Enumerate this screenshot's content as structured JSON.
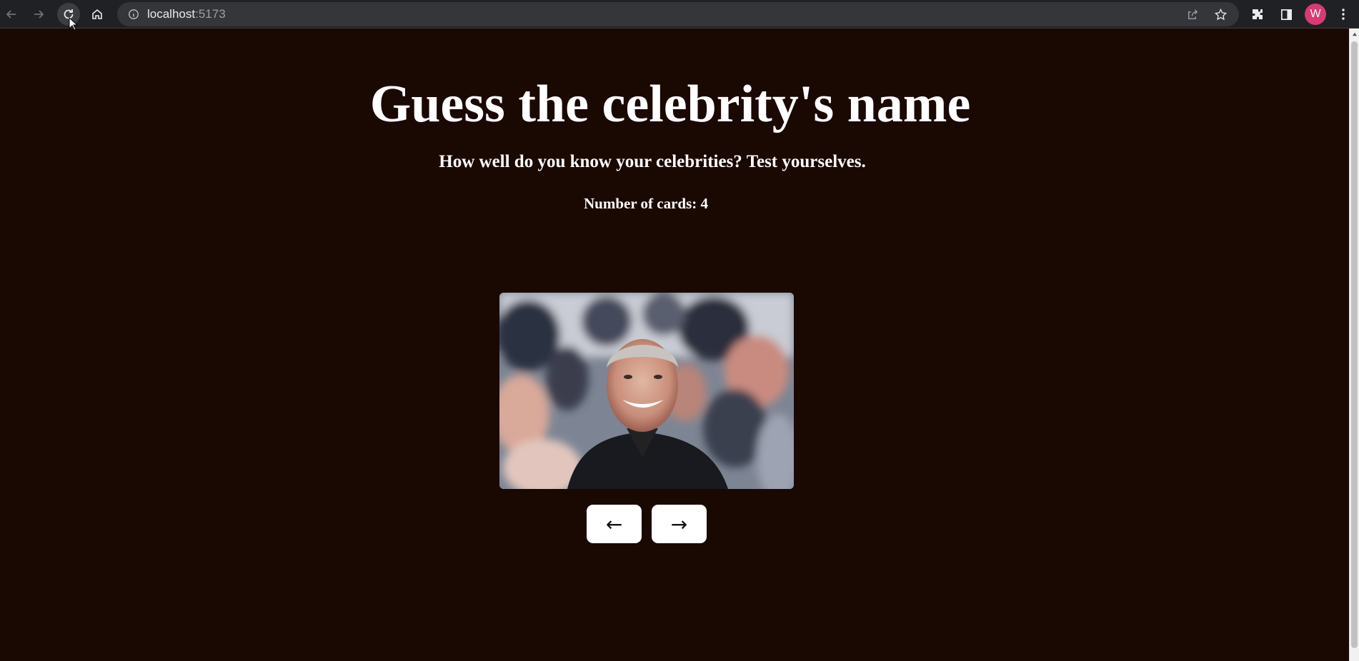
{
  "browser": {
    "url_host": "localhost",
    "url_port": ":5173",
    "profile_initial": "W"
  },
  "page": {
    "title": "Guess the celebrity's name",
    "subtitle": "How well do you know your celebrities? Test yourselves.",
    "card_count": "Number of cards: 4",
    "prev_label": "←",
    "next_label": "→"
  },
  "colors": {
    "background": "#1a0803",
    "button": "#ffffff",
    "avatar": "#d93a74"
  }
}
